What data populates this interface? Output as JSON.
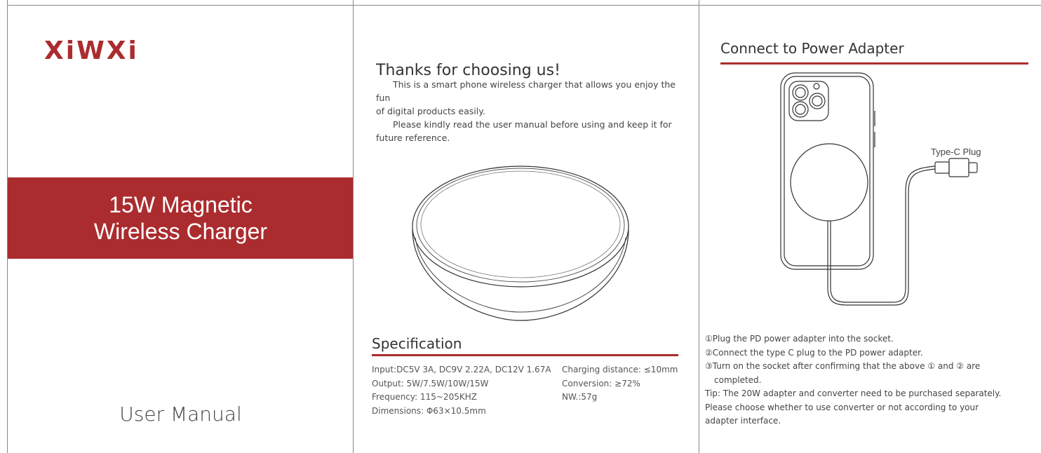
{
  "cover": {
    "brand": "XiWXi",
    "title_line1": "15W Magnetic",
    "title_line2": "Wireless Charger",
    "subtitle": "User Manual",
    "accent_color": "#ab2c2f"
  },
  "intro": {
    "heading": "Thanks for choosing us!",
    "paragraph1_line1": "This is a smart phone wireless charger that allows you enjoy the fun",
    "paragraph1_line2": "of digital products easily.",
    "paragraph2_line1": "Please kindly read the user manual before using and keep it for",
    "paragraph2_line2": "future reference."
  },
  "specification": {
    "heading": "Specification",
    "left": [
      "Input:DC5V 3A, DC9V 2.22A, DC12V 1.67A",
      "Output: 5W/7.5W/10W/15W",
      "Frequency: 115~205KHZ",
      "Dimensions: Φ63×10.5mm"
    ],
    "right": [
      "Charging distance: ≤10mm",
      "Conversion: ≥72%",
      "NW.:57g"
    ]
  },
  "connect": {
    "heading": "Connect to Power Adapter",
    "plug_label": "Type-C Plug",
    "step1": "①Plug the PD power adapter into the socket.",
    "step2": "②Connect the type C plug to the PD power adapter.",
    "step3_line1": "③Turn on the socket after confirming that the above ① and ② are",
    "step3_line2": "completed.",
    "tip_line1": "Tip: The 20W adapter and converter need to be purchased separately.",
    "tip_line2": "Please choose whether to use converter or not according to your",
    "tip_line3": "adapter interface."
  }
}
